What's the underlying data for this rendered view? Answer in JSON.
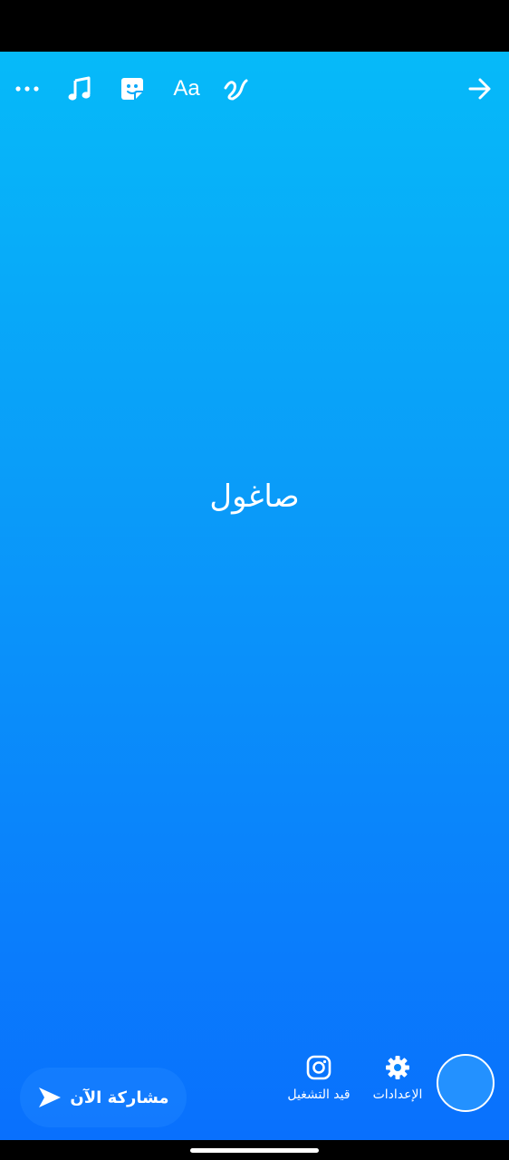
{
  "toolbar": {
    "more_icon": "more-horizontal-icon",
    "music_icon": "music-note-icon",
    "sticker_icon": "sticker-icon",
    "text_label": "Aa",
    "draw_icon": "squiggle-draw-icon",
    "next_icon": "arrow-right-icon"
  },
  "canvas": {
    "text": "صاغول",
    "gradient_top": "#06baf9",
    "gradient_bottom": "#0970fd"
  },
  "bottom": {
    "share_label": "مشاركة الآن",
    "instagram_label": "قيد التشغيل",
    "settings_label": "الإعدادات"
  }
}
